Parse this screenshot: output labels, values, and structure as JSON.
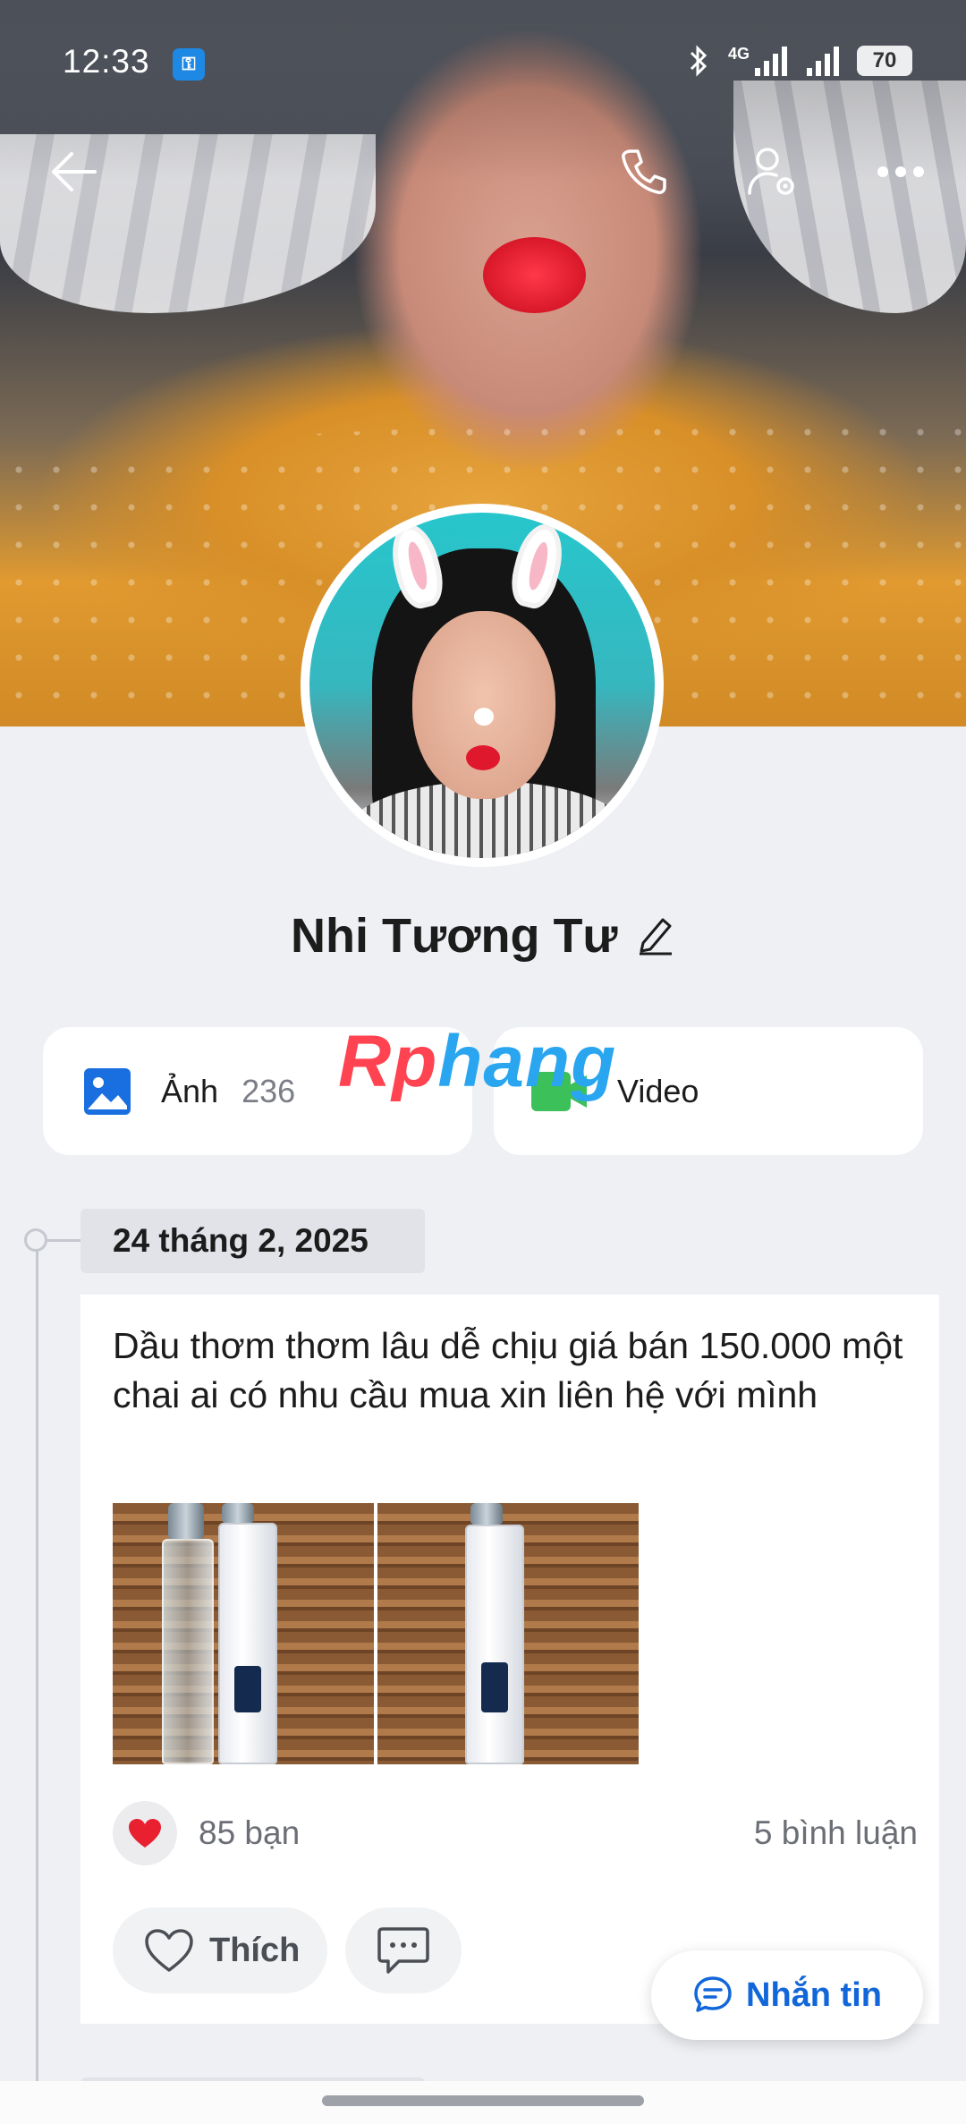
{
  "status_bar": {
    "time": "12:33",
    "battery": "70",
    "network": "4G",
    "icons": [
      "vpn-key-icon",
      "bluetooth-icon",
      "signal-icon",
      "signal-icon",
      "battery-icon"
    ]
  },
  "header": {
    "icons": [
      "back-arrow-icon",
      "phone-icon",
      "profile-settings-icon",
      "more-icon"
    ]
  },
  "profile": {
    "name": "Nhi Tương Tư"
  },
  "media": {
    "photos_label": "Ảnh",
    "photos_count": "236",
    "videos_label": "Video",
    "watermark_part1": "Rp",
    "watermark_part2": "hang"
  },
  "timeline": {
    "date": "24 tháng 2, 2025"
  },
  "post": {
    "text": "Dầu thơm thơm lâu dễ chịu giá bán 150.000 một chai ai có nhu cầu mua xin liên hệ với mình",
    "likes_text": "85 bạn",
    "comments_text": "5 bình luận",
    "like_label": "Thích",
    "more": "..."
  },
  "floating": {
    "message_label": "Nhắn tin"
  },
  "colors": {
    "accent": "#1166d9",
    "background": "#eef0f4",
    "heart": "#e8202f",
    "video_icon": "#3cc05a",
    "photo_icon": "#1a6fe0"
  }
}
